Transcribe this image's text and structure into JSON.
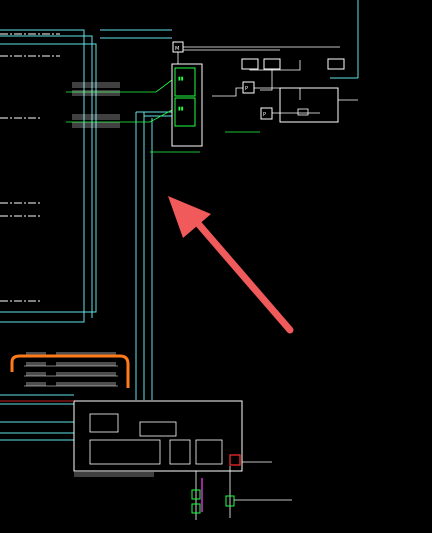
{
  "canvas": {
    "background": "#000000",
    "colors": {
      "cyan": "#5fe3e8",
      "white": "#ffffff",
      "green": "#22ff44",
      "yellow": "#ffd84a",
      "orange": "#ff7a1a",
      "red": "#ff3030",
      "magenta": "#ff44ff",
      "arrow": "#f05a5a"
    }
  },
  "symbols": {
    "motor_label": "M",
    "pump_label_a": "P",
    "pump_label_b": "P"
  },
  "annotation": {
    "arrow": {
      "icon": "pointer-arrow",
      "color": "#f05a5a"
    }
  }
}
